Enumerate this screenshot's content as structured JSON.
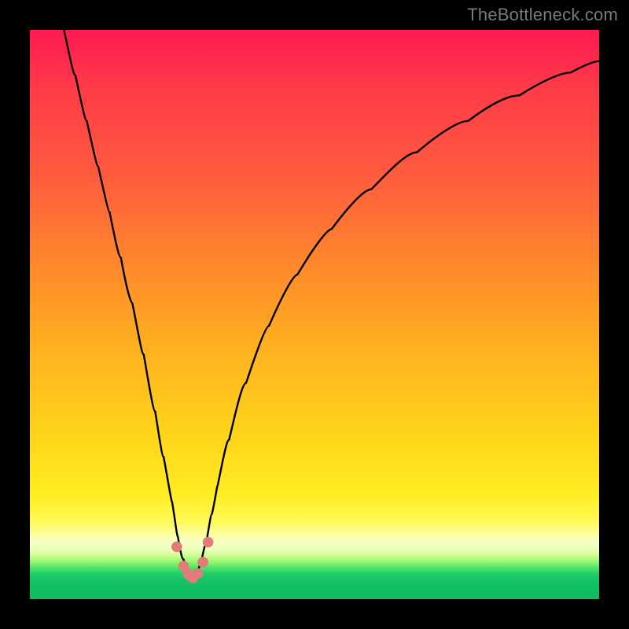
{
  "watermark": {
    "text": "TheBottleneck.com"
  },
  "colors": {
    "page_bg": "#000000",
    "curve": "#000000",
    "marker_fill": "#e47a7a",
    "marker_stroke": "#c45a5a",
    "gradient_top": "#ff1a52",
    "gradient_mid": "#ffd61a",
    "gradient_band": "#fcff9e",
    "gradient_bottom": "#12bf62"
  },
  "chart_data": {
    "type": "line",
    "title": "",
    "xlabel": "",
    "ylabel": "",
    "xlim": [
      0,
      100
    ],
    "ylim": [
      0,
      100
    ],
    "grid": false,
    "legend": false,
    "series": [
      {
        "name": "bottleneck-curve",
        "x": [
          6,
          8,
          10,
          12,
          14,
          16,
          18,
          20,
          22,
          23.5,
          25,
          26,
          27,
          27.8,
          28.5,
          29.2,
          30,
          31,
          32,
          33,
          35,
          38,
          42,
          47,
          53,
          60,
          68,
          77,
          86,
          95,
          100
        ],
        "values": [
          100,
          92,
          84,
          76,
          68,
          60,
          52,
          43,
          33,
          25,
          17,
          11,
          7,
          4.5,
          3.3,
          4.0,
          6.2,
          10,
          15,
          20,
          28,
          38,
          48,
          57,
          65,
          72,
          78.5,
          84,
          88.5,
          92.5,
          94.5
        ]
      }
    ],
    "markers": {
      "name": "trough-markers",
      "x": [
        25.8,
        27.0,
        27.8,
        28.6,
        29.5,
        30.4,
        31.3
      ],
      "values": [
        9.2,
        5.8,
        4.4,
        3.7,
        4.5,
        6.5,
        10.0
      ]
    },
    "gradient_bands_pct_from_top": {
      "red_to_yellow_end": 86.5,
      "pale_yellow_center": 89.5,
      "green_start": 92.5
    }
  }
}
